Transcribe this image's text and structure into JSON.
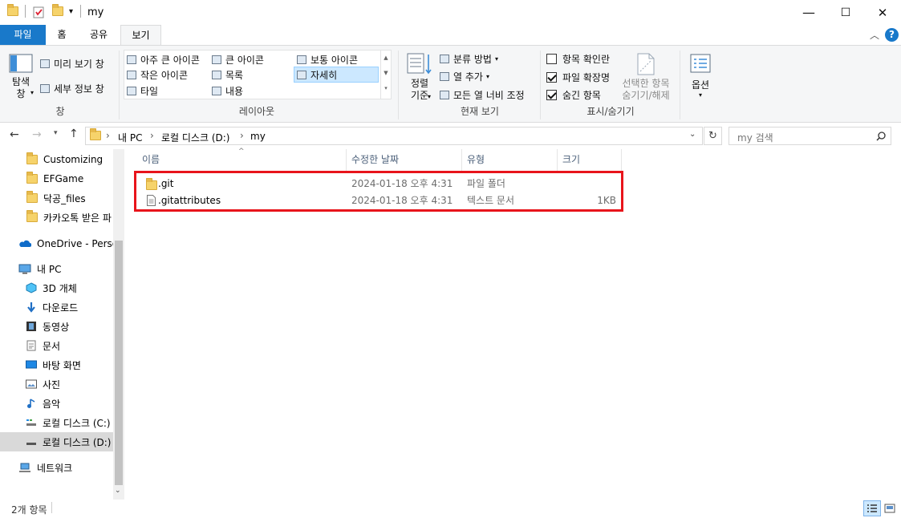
{
  "window": {
    "title": "my",
    "controls": {
      "minimize": "—",
      "maximize": "☐",
      "close": "✕"
    }
  },
  "ribbon_tabs": [
    "파일",
    "홈",
    "공유",
    "보기"
  ],
  "ribbon": {
    "pane": {
      "nav_pane": "탐색\n창",
      "preview": "미리 보기 창",
      "details": "세부 정보 창",
      "label": "창"
    },
    "layout": {
      "items": [
        "아주 큰 아이콘",
        "큰 아이콘",
        "보통 아이콘",
        "작은 아이콘",
        "목록",
        "자세히",
        "타일",
        "내용"
      ],
      "label": "레이아웃",
      "selected": "자세히"
    },
    "current_view": {
      "sort": "정렬\n기준",
      "group_by": "분류 방법",
      "add_columns": "열 추가",
      "fit_columns": "모든 열 너비 조정",
      "label": "현재 보기"
    },
    "show_hide": {
      "item_checkboxes": "항목 확인란",
      "file_extensions": "파일 확장명",
      "hidden_items": "숨긴 항목",
      "hide_selected": "선택한 항목\n숨기기/해제",
      "label": "표시/숨기기",
      "checked": {
        "item_checkboxes": false,
        "file_extensions": true,
        "hidden_items": true
      }
    },
    "options": "옵션"
  },
  "address": {
    "breadcrumb": [
      "내 PC",
      "로컬 디스크 (D:)",
      "my"
    ],
    "search_placeholder": "my 검색"
  },
  "sidebar": [
    {
      "label": "Customizing",
      "icon": "folder-icon"
    },
    {
      "label": "EFGame",
      "icon": "folder-icon"
    },
    {
      "label": "닥공_files",
      "icon": "folder-icon"
    },
    {
      "label": "카카오톡 받은 파",
      "icon": "folder-icon"
    },
    {
      "label": "OneDrive - Perso",
      "icon": "onedrive-icon"
    },
    {
      "label": "내 PC",
      "icon": "pc-icon"
    },
    {
      "label": "3D 개체",
      "icon": "3d-objects-icon"
    },
    {
      "label": "다운로드",
      "icon": "download-icon"
    },
    {
      "label": "동영상",
      "icon": "video-icon"
    },
    {
      "label": "문서",
      "icon": "document-icon"
    },
    {
      "label": "바탕 화면",
      "icon": "desktop-icon"
    },
    {
      "label": "사진",
      "icon": "pictures-icon"
    },
    {
      "label": "음악",
      "icon": "music-icon"
    },
    {
      "label": "로컬 디스크 (C:)",
      "icon": "drive-icon"
    },
    {
      "label": "로컬 디스크 (D:)",
      "icon": "drive-icon"
    },
    {
      "label": "네트워크",
      "icon": "network-icon"
    }
  ],
  "columns": [
    "이름",
    "수정한 날짜",
    "유형",
    "크기"
  ],
  "files": [
    {
      "name": ".git",
      "modified": "2024-01-18 오후 4:31",
      "type": "파일 폴더",
      "size": "",
      "icon": "folder-icon"
    },
    {
      "name": ".gitattributes",
      "modified": "2024-01-18 오후 4:31",
      "type": "텍스트 문서",
      "size": "1KB",
      "icon": "text-file-icon"
    }
  ],
  "status": {
    "item_count": "2개 항목"
  },
  "colors": {
    "file_tab": "#1979ca",
    "highlight_box": "#e8141b",
    "selected_nav": "#cce8ff",
    "help": "#1979ca"
  }
}
